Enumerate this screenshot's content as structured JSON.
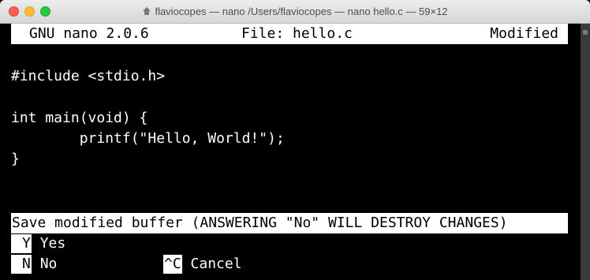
{
  "window": {
    "title": "flaviocopes — nano  /Users/flaviocopes — nano hello.c — 59×12"
  },
  "nano": {
    "header_left": "GNU nano 2.0.6",
    "header_center": "File: hello.c",
    "header_right": "Modified",
    "code_lines": [
      "#include <stdio.h>",
      "",
      "int main(void) {",
      "        printf(\"Hello, World!\");",
      "}"
    ],
    "prompt": "Save modified buffer (ANSWERING \"No\" WILL DESTROY CHANGES)",
    "options": {
      "yes_key": "Y",
      "yes_label": "Yes",
      "no_key": "N",
      "no_label": "No",
      "cancel_key": "^C",
      "cancel_label": "Cancel"
    }
  },
  "colors": {
    "terminal_bg": "#000000",
    "terminal_fg": "#ffffff",
    "close": "#fe5f57",
    "minimize": "#febb2e",
    "maximize": "#28c840"
  },
  "icons": [
    "close-button",
    "minimize-button",
    "maximize-button",
    "home-icon"
  ]
}
